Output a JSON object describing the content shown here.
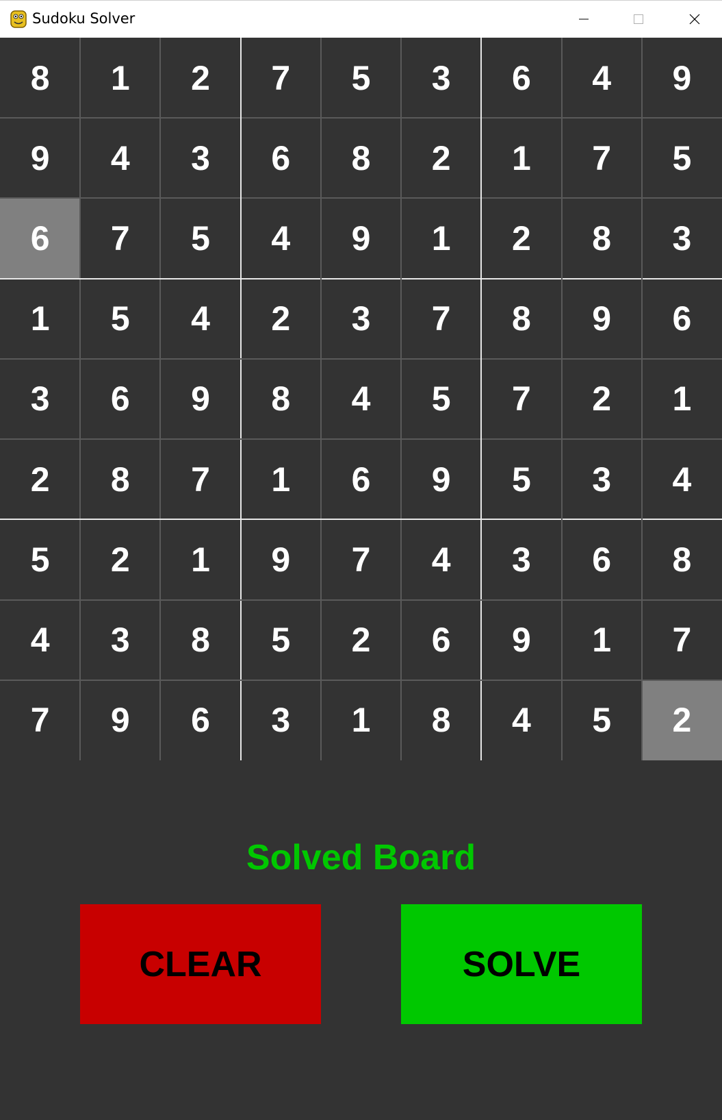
{
  "window": {
    "title": "Sudoku Solver",
    "app_icon": "python-icon"
  },
  "board": {
    "rows": [
      [
        "8",
        "1",
        "2",
        "7",
        "5",
        "3",
        "6",
        "4",
        "9"
      ],
      [
        "9",
        "4",
        "3",
        "6",
        "8",
        "2",
        "1",
        "7",
        "5"
      ],
      [
        "6",
        "7",
        "5",
        "4",
        "9",
        "1",
        "2",
        "8",
        "3"
      ],
      [
        "1",
        "5",
        "4",
        "2",
        "3",
        "7",
        "8",
        "9",
        "6"
      ],
      [
        "3",
        "6",
        "9",
        "8",
        "4",
        "5",
        "7",
        "2",
        "1"
      ],
      [
        "2",
        "8",
        "7",
        "1",
        "6",
        "9",
        "5",
        "3",
        "4"
      ],
      [
        "5",
        "2",
        "1",
        "9",
        "7",
        "4",
        "3",
        "6",
        "8"
      ],
      [
        "4",
        "3",
        "8",
        "5",
        "2",
        "6",
        "9",
        "1",
        "7"
      ],
      [
        "7",
        "9",
        "6",
        "3",
        "1",
        "8",
        "4",
        "5",
        "2"
      ]
    ],
    "highlighted_cells": [
      [
        2,
        0
      ],
      [
        8,
        8
      ]
    ]
  },
  "status": {
    "text": "Solved Board",
    "color": "#00c800"
  },
  "buttons": {
    "clear_label": "CLEAR",
    "solve_label": "SOLVE",
    "clear_color": "#c80000",
    "solve_color": "#00c800"
  },
  "colors": {
    "background": "#333333",
    "highlight": "#808080",
    "digit": "#ffffff"
  }
}
